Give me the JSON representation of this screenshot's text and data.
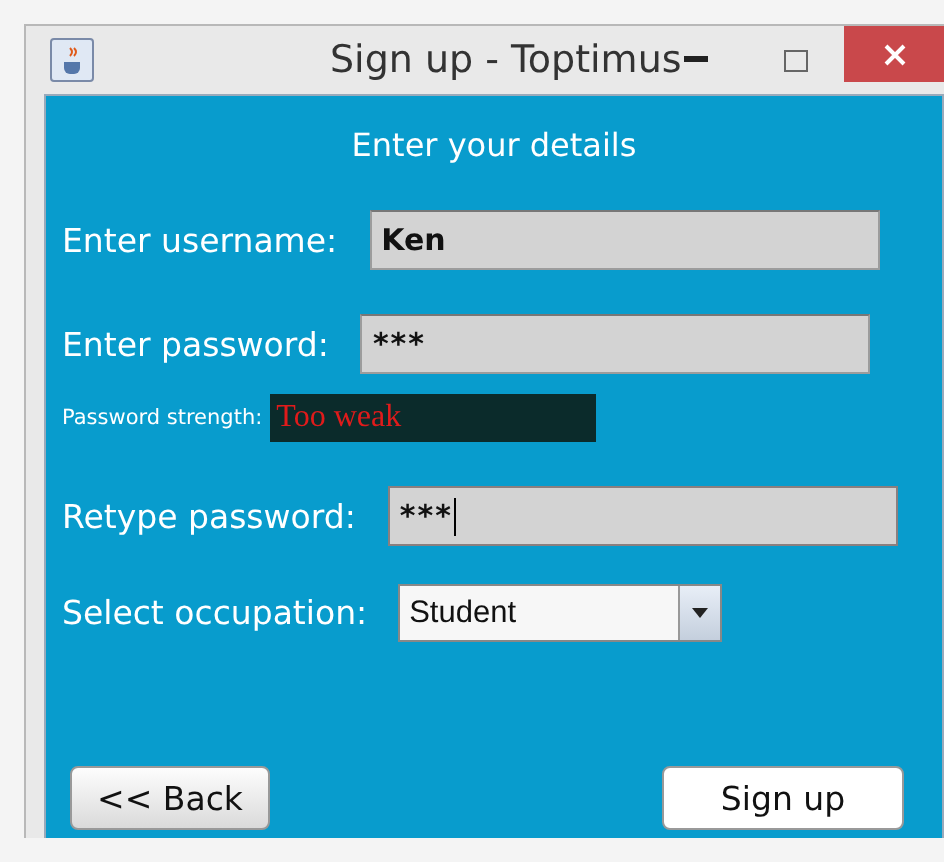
{
  "window": {
    "title": "Sign up - Toptimus"
  },
  "heading": "Enter your details",
  "form": [
    {
      "kind": "text",
      "label": "Enter username:",
      "value": "Ken",
      "focused": false
    },
    {
      "kind": "password",
      "label": "Enter password:",
      "value": "***",
      "focused": false
    },
    {
      "kind": "strength",
      "label": "Password strength:",
      "value": "Too weak"
    },
    {
      "kind": "password",
      "label": "Retype password:",
      "value": "***",
      "focused": true
    },
    {
      "kind": "select",
      "label": "Select occupation:",
      "value": "Student"
    }
  ],
  "buttons": [
    {
      "label": "<< Back",
      "kind": "secondary"
    },
    {
      "label": "Sign up",
      "kind": "primary"
    }
  ]
}
